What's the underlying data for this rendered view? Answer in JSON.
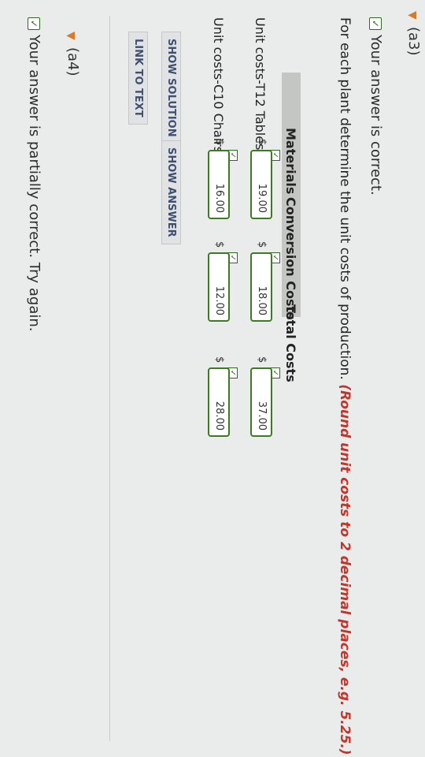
{
  "section_prev": {
    "label": "(a3)"
  },
  "status_correct": "Your answer is correct.",
  "instruction": {
    "text": "For each plant determine the unit costs of production.",
    "note": "(Round unit costs to 2 decimal places, e.g. 5.25.)"
  },
  "table": {
    "headers": [
      "Materials",
      "Conversion Costs",
      "Total Costs"
    ],
    "rows": [
      {
        "label": "Unit costs-T12 Tables",
        "values": [
          "19.00",
          "18.00",
          "37.00"
        ]
      },
      {
        "label": "Unit costs-C10 Chairs",
        "values": [
          "16.00",
          "12.00",
          "28.00"
        ]
      }
    ],
    "currency": "$"
  },
  "buttons": {
    "show_solution": "SHOW SOLUTION",
    "show_answer": "SHOW ANSWER",
    "link_to_text": "LINK TO TEXT"
  },
  "section_next": {
    "label": "(a4)"
  },
  "status_partial": "Your answer is partially correct.  Try again."
}
